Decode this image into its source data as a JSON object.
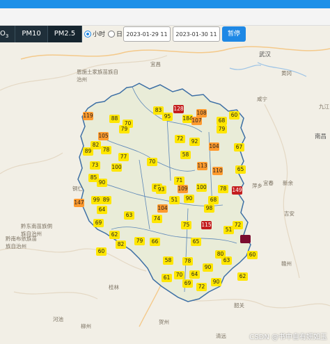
{
  "toolbar": {
    "pollutants": [
      {
        "label": "O3",
        "active": false
      },
      {
        "label": "PM10",
        "active": false
      },
      {
        "label": "PM2.5",
        "active": true
      }
    ],
    "radio_hour": "小时",
    "radio_day": "日",
    "start_time": "2023-01-29 11",
    "end_time": "2023-01-30 11",
    "pause_label": "暂停"
  },
  "map": {
    "cities": [
      {
        "name": "宜昌"
      },
      {
        "name": "武汉"
      },
      {
        "name": "黄冈"
      },
      {
        "name": "咸宁"
      },
      {
        "name": "九江"
      },
      {
        "name": "南昌"
      },
      {
        "name": "萍乡"
      },
      {
        "name": "宜春"
      },
      {
        "name": "新余"
      },
      {
        "name": "吉安"
      },
      {
        "name": "赣州"
      },
      {
        "name": "韶关"
      },
      {
        "name": "清远"
      },
      {
        "name": "贺州"
      },
      {
        "name": "桂林"
      },
      {
        "name": "柳州"
      },
      {
        "name": "河池"
      },
      {
        "name": "铜仁"
      },
      {
        "name": "恩施土家族苗族自治州"
      },
      {
        "name": "黔东南苗族侗族自治州"
      },
      {
        "name": "黔南布依族苗族自治州"
      }
    ],
    "aqi_markers": [
      {
        "value": "83"
      },
      {
        "value": "128"
      },
      {
        "value": "108"
      },
      {
        "value": "60"
      },
      {
        "value": "119"
      },
      {
        "value": "88"
      },
      {
        "value": "95"
      },
      {
        "value": "184"
      },
      {
        "value": "107"
      },
      {
        "value": "68"
      },
      {
        "value": "70"
      },
      {
        "value": "105"
      },
      {
        "value": "79"
      },
      {
        "value": "79"
      },
      {
        "value": "72"
      },
      {
        "value": "92"
      },
      {
        "value": "89"
      },
      {
        "value": "82"
      },
      {
        "value": "78"
      },
      {
        "value": "58"
      },
      {
        "value": "104"
      },
      {
        "value": "67"
      },
      {
        "value": "73"
      },
      {
        "value": "100"
      },
      {
        "value": "77"
      },
      {
        "value": "70"
      },
      {
        "value": "113"
      },
      {
        "value": "110"
      },
      {
        "value": "65"
      },
      {
        "value": "85"
      },
      {
        "value": "90"
      },
      {
        "value": "87"
      },
      {
        "value": "93"
      },
      {
        "value": "109"
      },
      {
        "value": "71"
      },
      {
        "value": "100"
      },
      {
        "value": "78"
      },
      {
        "value": "147"
      },
      {
        "value": "99"
      },
      {
        "value": "89"
      },
      {
        "value": "64"
      },
      {
        "value": "104"
      },
      {
        "value": "90"
      },
      {
        "value": "63"
      },
      {
        "value": "74"
      },
      {
        "value": "75"
      },
      {
        "value": "98"
      },
      {
        "value": "69"
      },
      {
        "value": "62"
      },
      {
        "value": "79"
      },
      {
        "value": "72"
      },
      {
        "value": "65"
      },
      {
        "value": "51"
      },
      {
        "value": "82"
      },
      {
        "value": "66"
      },
      {
        "value": "60"
      },
      {
        "value": "58"
      },
      {
        "value": "78"
      },
      {
        "value": "90"
      },
      {
        "value": "80"
      },
      {
        "value": "63"
      },
      {
        "value": "60"
      },
      {
        "value": "61"
      },
      {
        "value": "70"
      },
      {
        "value": "64"
      },
      {
        "value": "69"
      },
      {
        "value": "72"
      },
      {
        "value": "90"
      },
      {
        "value": "62"
      },
      {
        "value": "115"
      },
      {
        "value": "149"
      },
      {
        "value": "68"
      },
      {
        "value": "51"
      }
    ]
  },
  "watermark": "CSDN @书中自有妍如玉"
}
